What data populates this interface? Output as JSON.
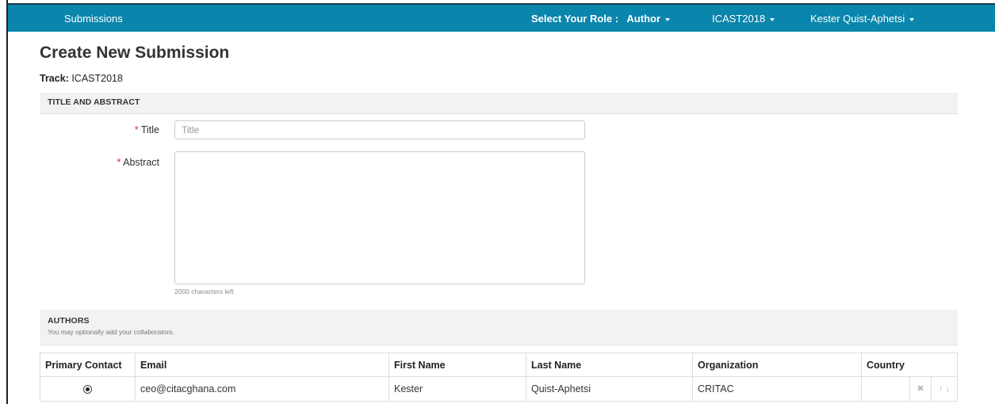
{
  "topbar": {
    "brand": "Submissions",
    "role_label": "Select Your Role :",
    "role_value": "Author",
    "conference": "ICAST2018",
    "user": "Kester Quist-Aphetsi",
    "bg_color": "#0a86ad"
  },
  "page": {
    "title": "Create New Submission",
    "track_label": "Track:",
    "track_value": "ICAST2018"
  },
  "title_abstract": {
    "heading": "TITLE AND ABSTRACT",
    "title_label": "Title",
    "title_placeholder": "Title",
    "title_value": "",
    "abstract_label": "Abstract",
    "abstract_value": "",
    "required_mark": "*",
    "chars_left": "2000 characters left"
  },
  "authors": {
    "heading": "AUTHORS",
    "subheading": "You may optionally add your collaborators.",
    "columns": [
      "Primary Contact",
      "Email",
      "First Name",
      "Last Name",
      "Organization",
      "Country"
    ],
    "rows": [
      {
        "primary": true,
        "email": "ceo@citacghana.com",
        "first_name": "Kester",
        "last_name": "Quist-Aphetsi",
        "organization": "CRITAC",
        "country": ""
      }
    ],
    "icons": [
      "remove-icon",
      "move-up-icon",
      "move-down-icon"
    ]
  }
}
